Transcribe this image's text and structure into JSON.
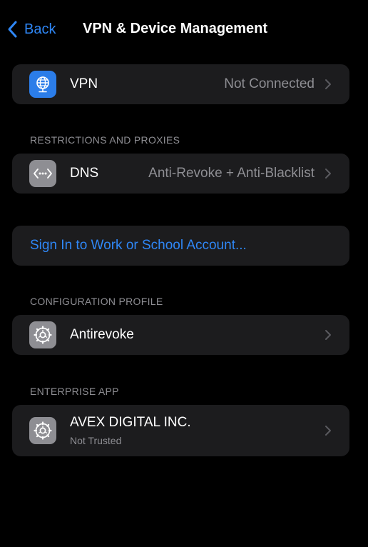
{
  "navbar": {
    "back_label": "Back",
    "title": "VPN & Device Management"
  },
  "vpn": {
    "label": "VPN",
    "value": "Not Connected",
    "icon": "globe-icon"
  },
  "restrictions": {
    "header": "RESTRICTIONS AND PROXIES",
    "dns_label": "DNS",
    "dns_value": "Anti-Revoke + Anti-Blacklist",
    "icon": "dns-icon"
  },
  "account": {
    "sign_in_label": "Sign In to Work or School Account..."
  },
  "configuration": {
    "header": "CONFIGURATION PROFILE",
    "profile_label": "Antirevoke",
    "icon": "gear-icon"
  },
  "enterprise": {
    "header": "ENTERPRISE APP",
    "app_label": "AVEX DIGITAL INC.",
    "app_status": "Not Trusted",
    "icon": "gear-icon"
  },
  "colors": {
    "background": "#000000",
    "cell": "#1c1c1e",
    "accent": "#2f87f6",
    "secondary_text": "#8e8e93",
    "vpn_icon_bg": "#2b7de9",
    "gray_icon_bg": "#8e8e93"
  }
}
